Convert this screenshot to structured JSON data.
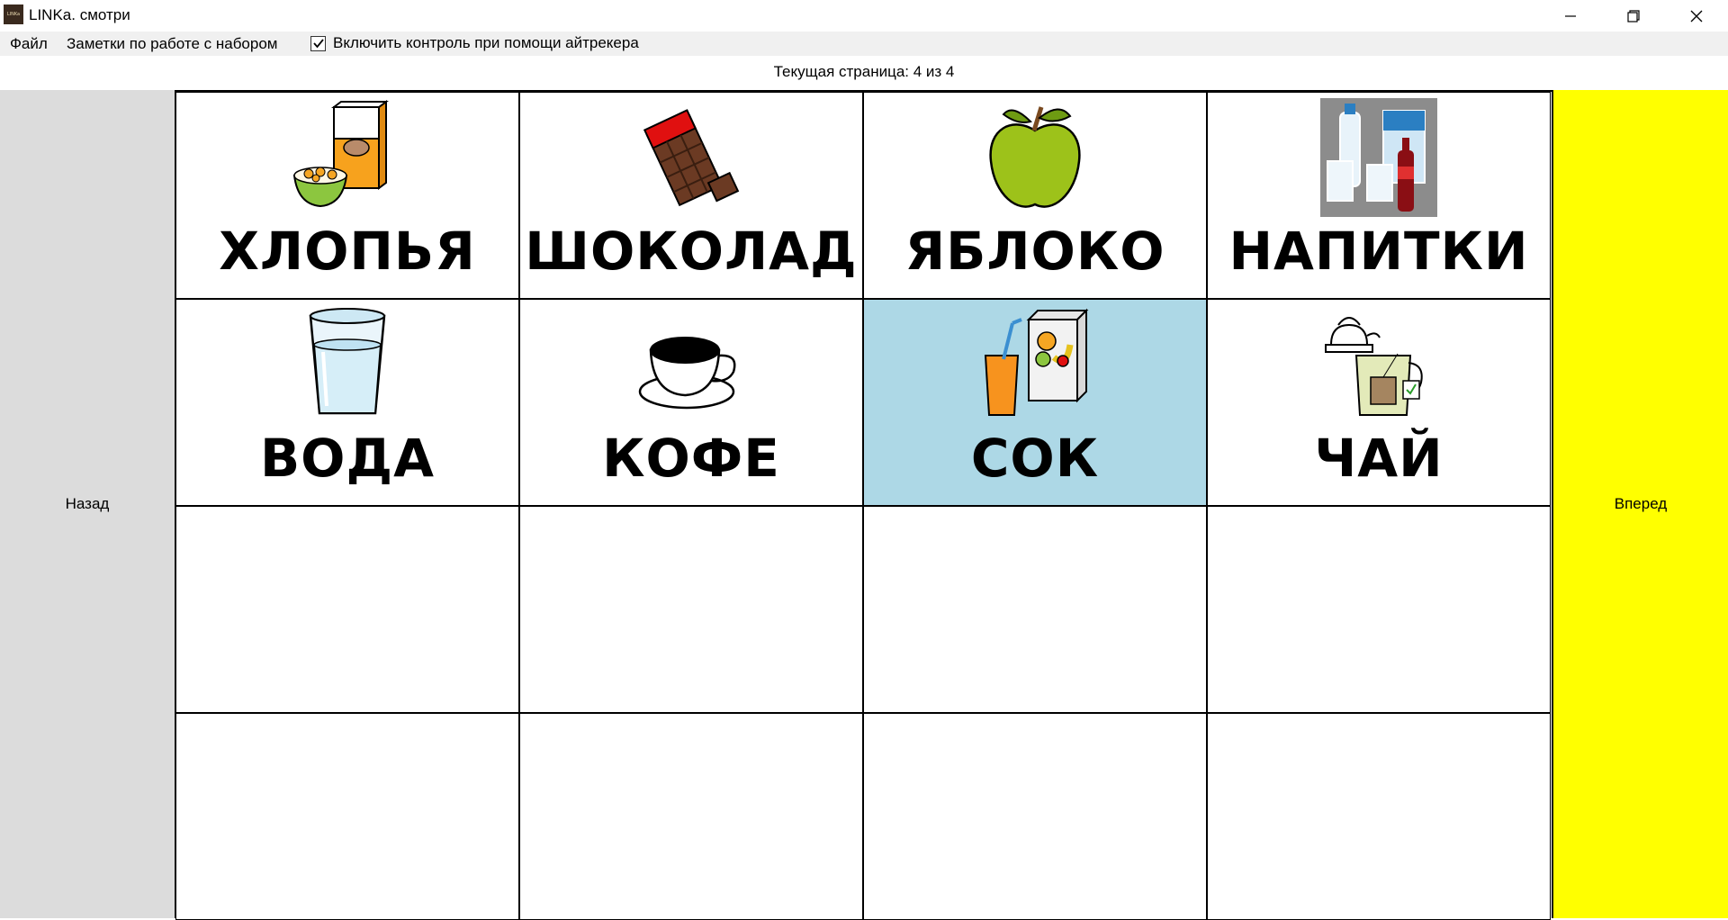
{
  "window": {
    "title": "LINKa. смотри",
    "icon_text": "LINKa"
  },
  "menu": {
    "file": "Файл",
    "notes": "Заметки по работе с набором",
    "eyetracker_toggle": {
      "label": "Включить контроль при помощи айтрекера",
      "checked": true
    }
  },
  "page_indicator": "Текущая страница: 4 из 4",
  "nav": {
    "back": "Назад",
    "forward": "Вперед"
  },
  "colors": {
    "selected_cell": "#add8e6",
    "forward_button": "#ffff00",
    "back_button": "#dcdcdc"
  },
  "cards": [
    {
      "word": "ХЛОПЬЯ",
      "icon": "cereal-icon"
    },
    {
      "word": "ШОКОЛАД",
      "icon": "chocolate-icon"
    },
    {
      "word": "ЯБЛОКО",
      "icon": "apple-icon"
    },
    {
      "word": "НАПИТКИ",
      "icon": "drinks-icon"
    },
    {
      "word": "ВОДА",
      "icon": "water-glass-icon"
    },
    {
      "word": "КОФЕ",
      "icon": "coffee-cup-icon"
    },
    {
      "word": "СОК",
      "icon": "juice-icon",
      "selected": true
    },
    {
      "word": "ЧАЙ",
      "icon": "tea-icon"
    }
  ]
}
